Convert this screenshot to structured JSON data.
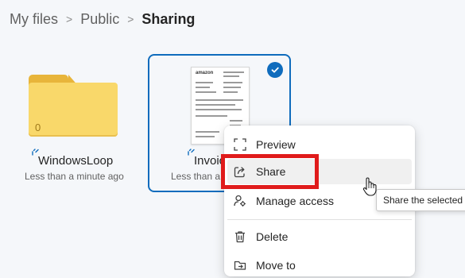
{
  "breadcrumb": {
    "items": [
      "My files",
      "Public",
      "Sharing"
    ],
    "separator": ">"
  },
  "files": [
    {
      "name": "WindowsLoop",
      "meta": "Less than a minute ago",
      "badge_count": "0",
      "type": "folder",
      "selected": false,
      "icon": "folder-icon"
    },
    {
      "name": "Invoic",
      "meta": "Less than a m",
      "type": "document",
      "selected": true,
      "icon": "invoice-thumbnail",
      "thumb_brand": "amazon"
    }
  ],
  "context_menu": {
    "items": [
      {
        "label": "Preview",
        "icon": "preview-icon"
      },
      {
        "label": "Share",
        "icon": "share-icon",
        "hovered": true
      },
      {
        "label": "Manage access",
        "icon": "manage-access-icon"
      },
      {
        "label": "Delete",
        "icon": "delete-icon"
      },
      {
        "label": "Move to",
        "icon": "move-to-icon"
      }
    ]
  },
  "tooltip": {
    "text": "Share the selected it"
  },
  "colors": {
    "accent": "#0f6cbd",
    "highlight": "#e01b1b",
    "folder": "#f9d86a",
    "background": "#f5f7fa"
  }
}
